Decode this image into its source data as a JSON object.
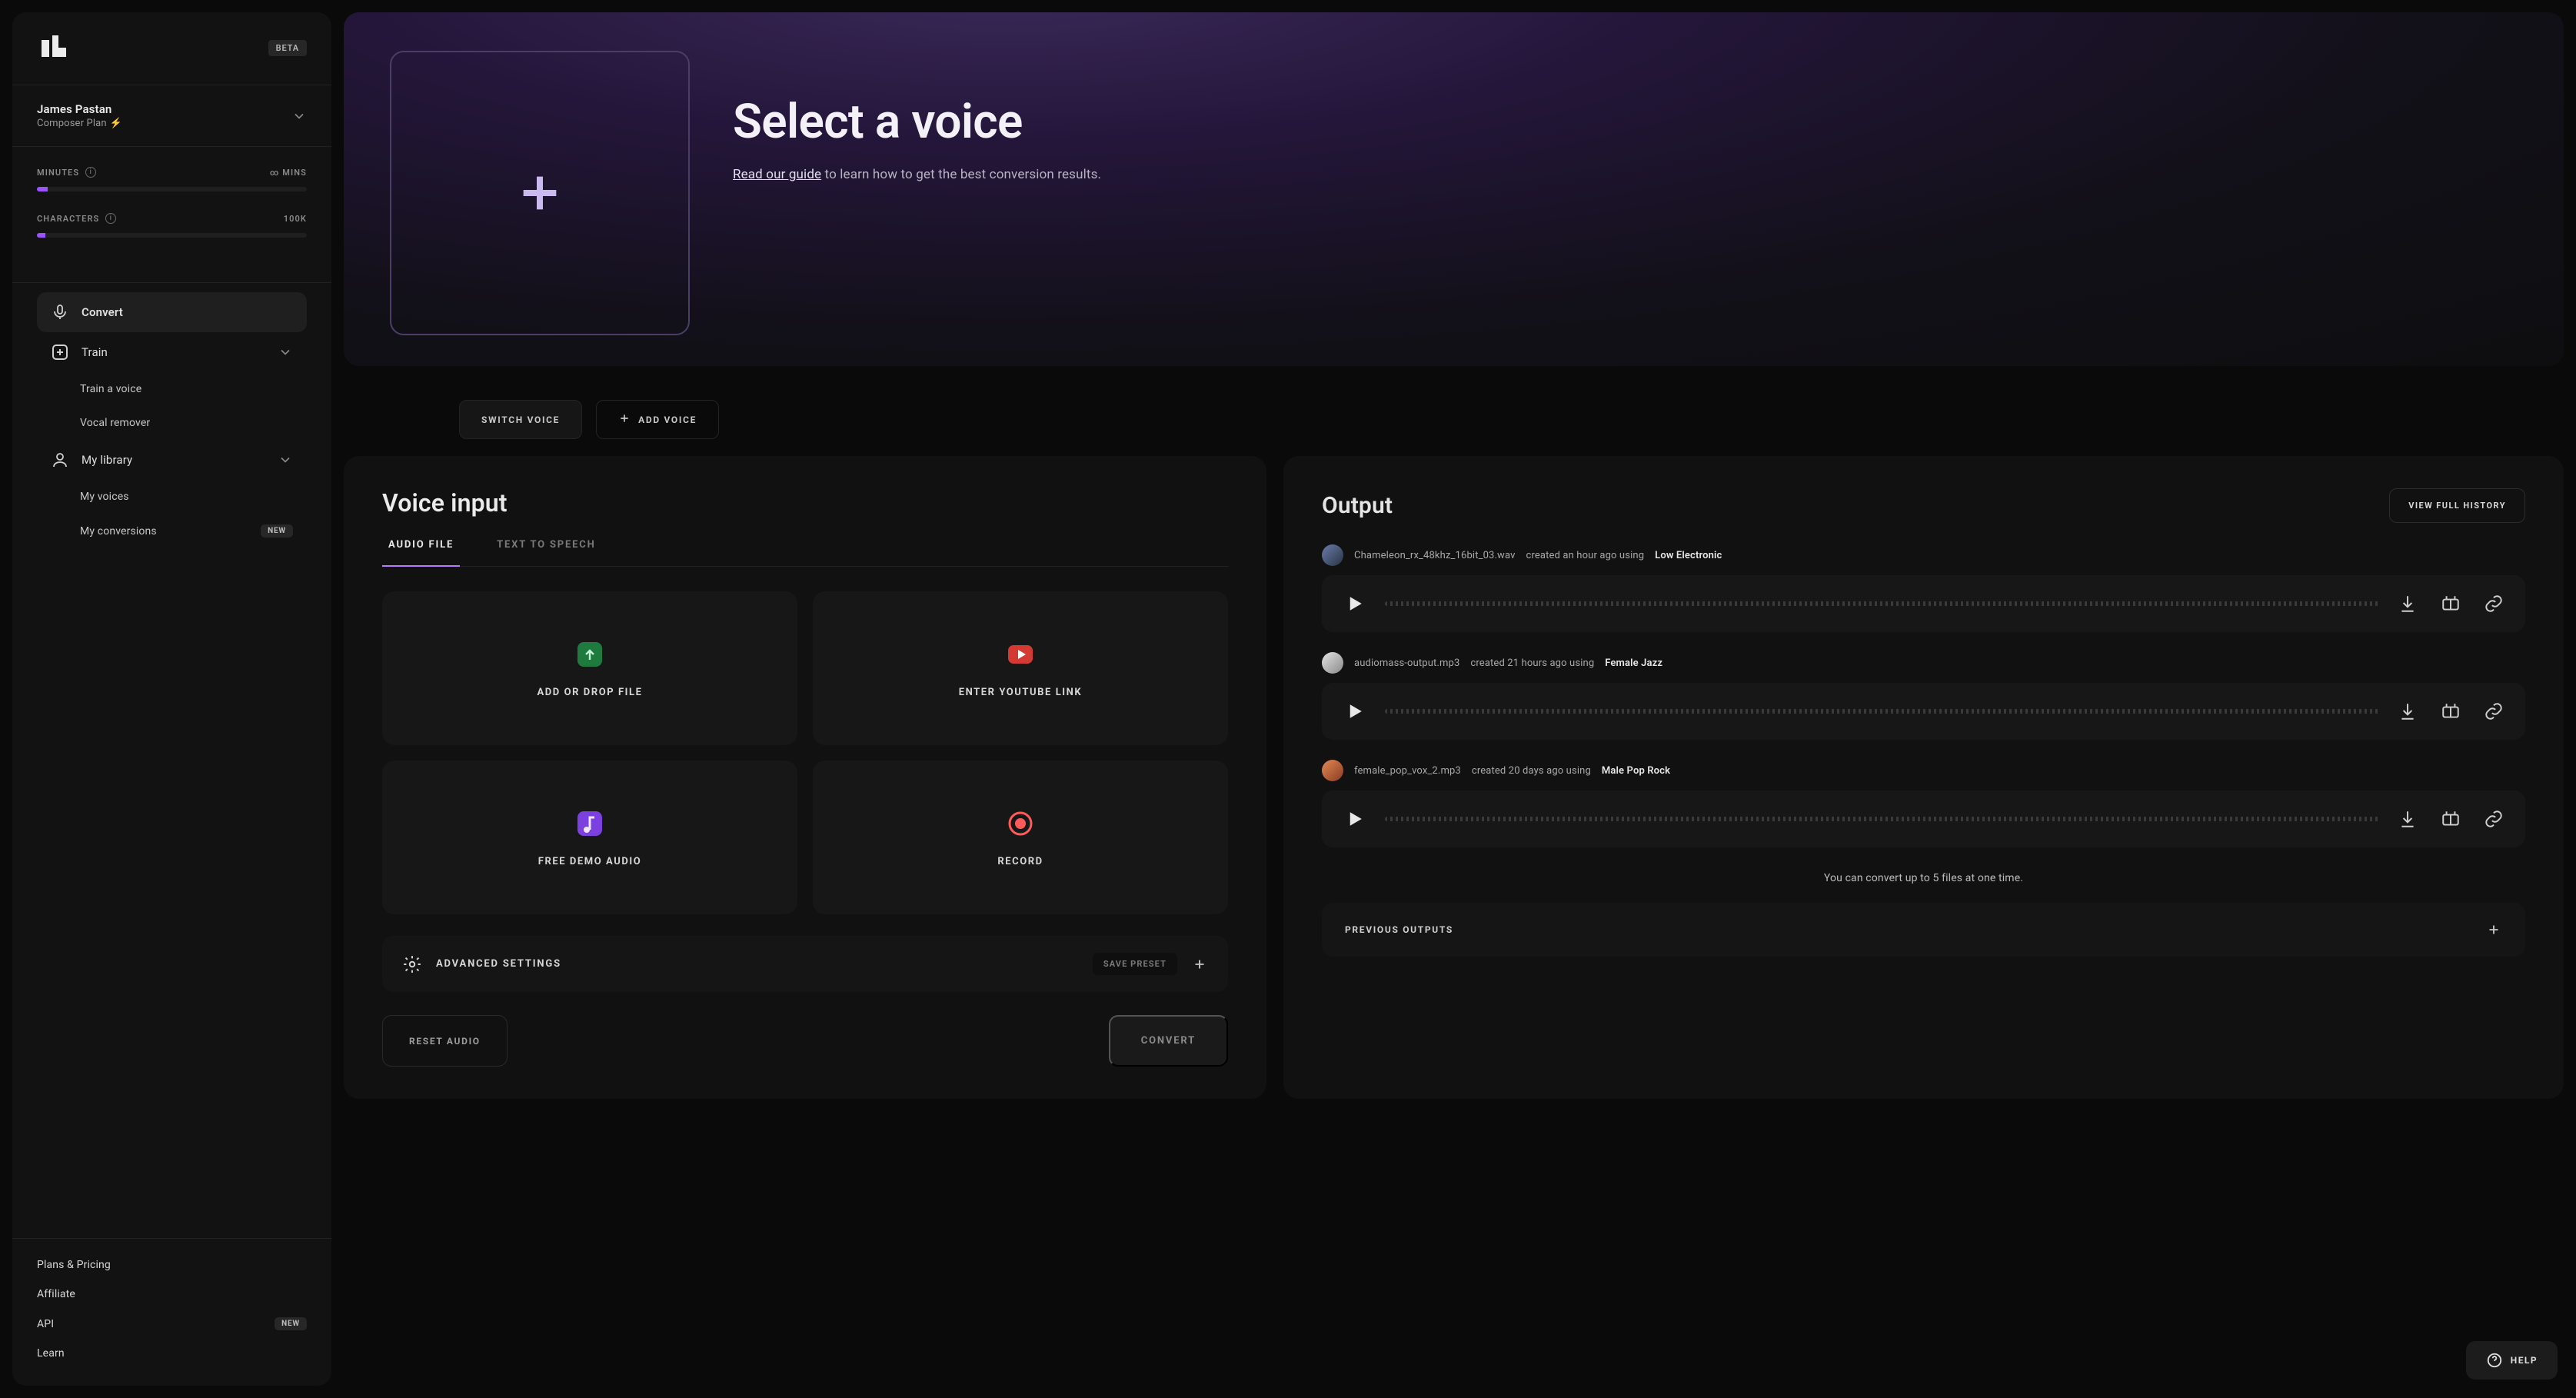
{
  "app": {
    "beta_label": "BETA"
  },
  "user": {
    "name": "James Pastan",
    "plan": "Composer Plan"
  },
  "meters": {
    "minutes": {
      "label": "MINUTES",
      "value": "∞ MINS"
    },
    "characters": {
      "label": "CHARACTERS",
      "value": "100K"
    }
  },
  "nav": {
    "convert": "Convert",
    "train": "Train",
    "train_sub": {
      "train_voice": "Train a voice",
      "vocal_remover": "Vocal remover"
    },
    "library": "My library",
    "library_sub": {
      "my_voices": "My voices",
      "my_conversions": "My conversions"
    },
    "new_badge": "NEW"
  },
  "sidebar_links": {
    "plans": "Plans & Pricing",
    "affiliate": "Affiliate",
    "api": "API",
    "learn": "Learn"
  },
  "hero": {
    "title": "Select a voice",
    "guide_link": "Read our guide",
    "guide_rest": " to learn how to get the best conversion results."
  },
  "hero_buttons": {
    "switch": "SWITCH VOICE",
    "add": "ADD VOICE"
  },
  "voice_input": {
    "title": "Voice input",
    "tab_audio": "AUDIO FILE",
    "tab_tts": "TEXT TO SPEECH",
    "tile_add": "ADD OR DROP FILE",
    "tile_youtube": "ENTER YOUTUBE LINK",
    "tile_demo": "FREE DEMO AUDIO",
    "tile_record": "RECORD",
    "advanced": "ADVANCED SETTINGS",
    "save_preset": "SAVE PRESET",
    "reset": "RESET AUDIO",
    "convert": "CONVERT"
  },
  "output": {
    "title": "Output",
    "view_history": "VIEW FULL HISTORY",
    "limit_note": "You can convert up to 5 files at one time.",
    "previous": "PREVIOUS OUTPUTS",
    "items": [
      {
        "file": "Chameleon_rx_48khz_16bit_03.wav",
        "meta": " created an hour ago using ",
        "model": "Low Electronic"
      },
      {
        "file": "audiomass-output.mp3",
        "meta": " created 21 hours ago using ",
        "model": "Female Jazz"
      },
      {
        "file": "female_pop_vox_2.mp3",
        "meta": " created 20 days ago using ",
        "model": "Male Pop Rock"
      }
    ]
  },
  "help": "HELP"
}
